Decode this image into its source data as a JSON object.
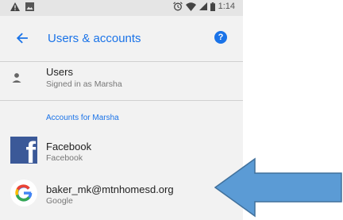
{
  "status_bar": {
    "time": "1:14"
  },
  "app_bar": {
    "title": "Users & accounts",
    "help_glyph": "?"
  },
  "users_row": {
    "title": "Users",
    "subtitle": "Signed in as Marsha"
  },
  "section": {
    "header": "Accounts for Marsha"
  },
  "accounts": [
    {
      "name": "Facebook",
      "type": "Facebook",
      "icon": "facebook-icon"
    },
    {
      "name": "baker_mk@mtnhomesd.org",
      "type": "Google",
      "icon": "google-icon"
    }
  ],
  "colors": {
    "accent": "#1a73e8",
    "facebook": "#3b5998",
    "arrow_fill": "#5b9bd5",
    "arrow_stroke": "#41719c"
  }
}
